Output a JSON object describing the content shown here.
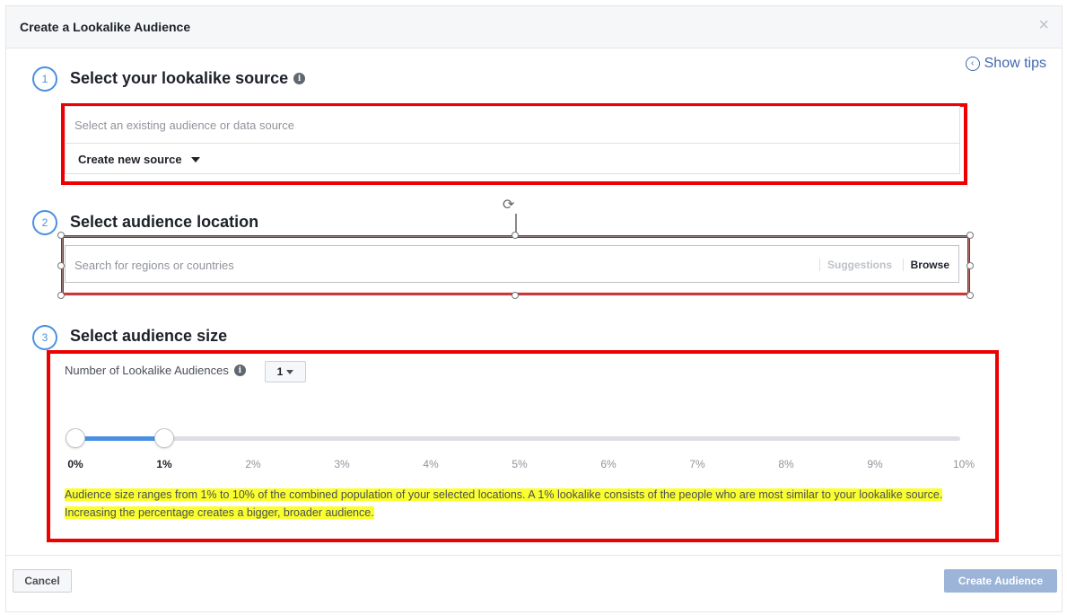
{
  "dialog": {
    "title": "Create a Lookalike Audience",
    "close_label": "×",
    "show_tips": "Show tips"
  },
  "source": {
    "step": "1",
    "title": "Select your lookalike source",
    "placeholder": "Select an existing audience or data source",
    "create_new": "Create new source"
  },
  "location": {
    "step": "2",
    "title": "Select audience location",
    "placeholder": "Search for regions or countries",
    "suggestions": "Suggestions",
    "browse": "Browse"
  },
  "size": {
    "step": "3",
    "title": "Select audience size",
    "count_label": "Number of Lookalike Audiences",
    "count_value": "1",
    "slider_start_percent": 0,
    "slider_end_percent": 1,
    "ticks": [
      "0%",
      "1%",
      "2%",
      "3%",
      "4%",
      "5%",
      "6%",
      "7%",
      "8%",
      "9%",
      "10%"
    ],
    "description": "Audience size ranges from 1% to 10% of the combined population of your selected locations. A 1% lookalike consists of the people who are most similar to your lookalike source. Increasing the percentage creates a bigger, broader audience."
  },
  "footer": {
    "cancel": "Cancel",
    "create": "Create Audience"
  },
  "colors": {
    "accent": "#4a90e2",
    "link": "#4267b2",
    "annotation_box": "#ee0000",
    "highlight": "#fbff2e",
    "create_button_disabled": "#9cb4d8"
  }
}
